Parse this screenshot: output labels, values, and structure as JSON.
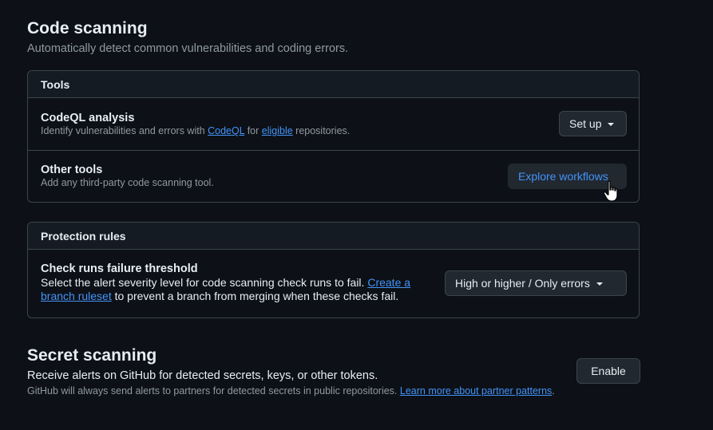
{
  "code_scanning": {
    "title": "Code scanning",
    "description": "Automatically detect common vulnerabilities and coding errors."
  },
  "tools": {
    "header": "Tools",
    "codeql": {
      "title": "CodeQL analysis",
      "desc_prefix": "Identify vulnerabilities and errors with ",
      "link1": "CodeQL",
      "desc_mid": " for ",
      "link2": "eligible",
      "desc_suffix": " repositories.",
      "button": "Set up"
    },
    "other": {
      "title": "Other tools",
      "desc": "Add any third-party code scanning tool.",
      "button": "Explore workflows"
    }
  },
  "protection": {
    "header": "Protection rules",
    "threshold": {
      "title": "Check runs failure threshold",
      "desc_prefix": "Select the alert severity level for code scanning check runs to fail. ",
      "link": "Create a branch ruleset",
      "desc_suffix": " to prevent a branch from merging when these checks fail.",
      "select_value": "High or higher / Only errors"
    }
  },
  "secret_scanning": {
    "title": "Secret scanning",
    "description": "Receive alerts on GitHub for detected secrets, keys, or other tokens.",
    "note_prefix": "GitHub will always send alerts to partners for detected secrets in public repositories. ",
    "note_link": "Learn more about partner patterns",
    "note_suffix": ".",
    "button": "Enable"
  },
  "colors": {
    "background": "#0d1117",
    "border": "#3d444d",
    "link": "#4493f8",
    "muted_text": "#9198a1",
    "button_bg": "#212830"
  },
  "icons": {
    "caret": "triangle-down-icon",
    "cursor": "hand-pointer-cursor"
  }
}
